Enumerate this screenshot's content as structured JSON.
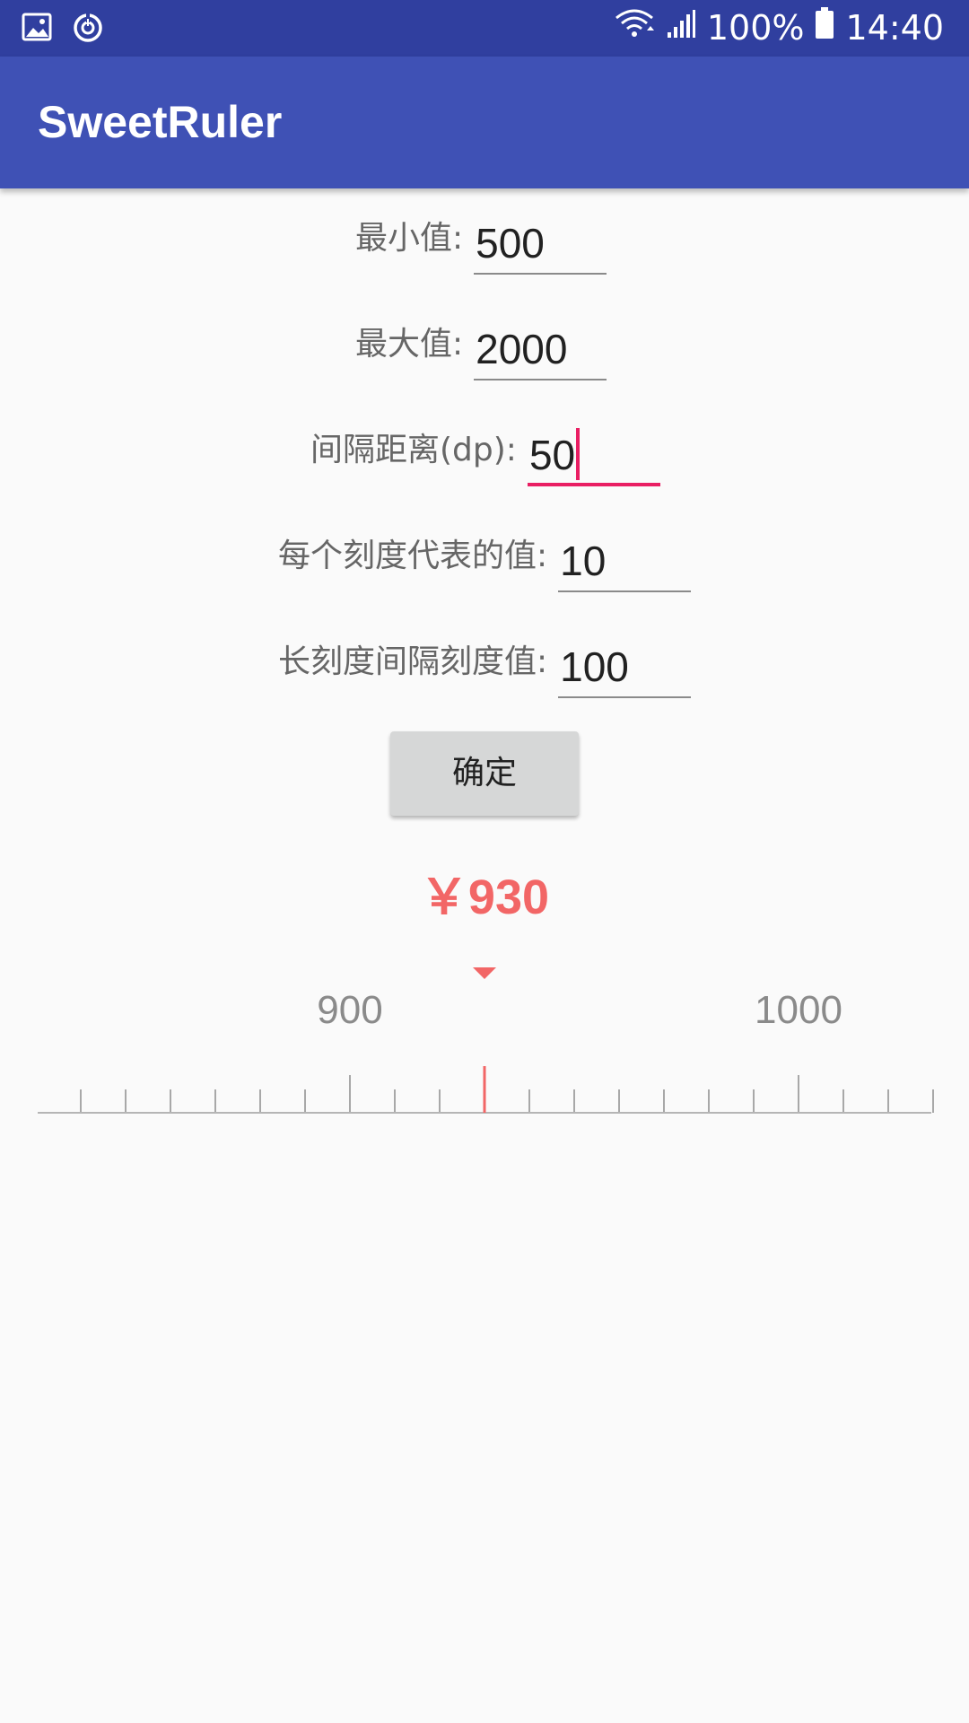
{
  "status_bar": {
    "icons_left": [
      "image-icon",
      "sync-icon"
    ],
    "icons_right": [
      "wifi-icon",
      "signal-icon",
      "battery-icon"
    ],
    "battery": "100%",
    "time": "14:40"
  },
  "app_bar": {
    "title": "SweetRuler"
  },
  "form": {
    "min_label": "最小值:",
    "min_value": "500",
    "max_label": "最大值:",
    "max_value": "2000",
    "gap_label": "间隔距离(dp):",
    "gap_value": "50",
    "per_tick_label": "每个刻度代表的值:",
    "per_tick_value": "10",
    "long_tick_label": "长刻度间隔刻度值:",
    "long_tick_value": "100",
    "confirm_label": "确定"
  },
  "result": {
    "price": "￥930"
  },
  "ruler": {
    "current_value": 930,
    "tick_step": 10,
    "long_tick_every": 100,
    "visible_from": 840,
    "visible_to": 1030,
    "labels": [
      "900",
      "1000"
    ],
    "colors": {
      "indicator": "#f26666",
      "ticks": "#a8a8a8",
      "labels": "#8a8a8a"
    }
  }
}
